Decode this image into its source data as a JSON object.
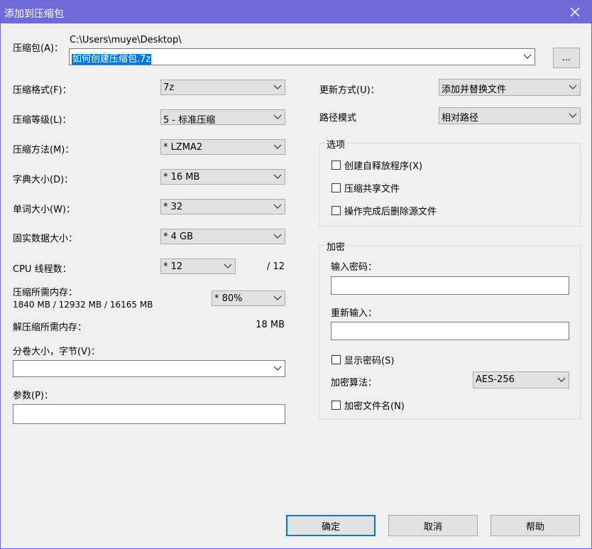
{
  "window": {
    "title": "添加到压缩包",
    "close_glyph": "✕"
  },
  "archive": {
    "label": "压缩包(A)：",
    "path": "C:\\Users\\muye\\Desktop\\",
    "name": "如何创建压缩包.7z",
    "browse": "..."
  },
  "left": {
    "format": {
      "label": "压缩格式(F)：",
      "value": "7z"
    },
    "level": {
      "label": "压缩等级(L)：",
      "value": "5 - 标准压缩"
    },
    "method": {
      "label": "压缩方法(M)：",
      "value": "* LZMA2"
    },
    "dict": {
      "label": "字典大小(D)：",
      "value": "* 16 MB"
    },
    "word": {
      "label": "单词大小(W)：",
      "value": "* 32"
    },
    "solid": {
      "label": "固实数据大小：",
      "value": "* 4 GB"
    },
    "threads": {
      "label": "CPU 线程数：",
      "value": "* 12",
      "max": "/ 12"
    },
    "mem": {
      "label": "压缩所需内存：",
      "detail": "1840 MB / 12932 MB / 16165 MB",
      "value": "* 80%"
    },
    "decomp": {
      "label": "解压缩所需内存：",
      "value": "18 MB"
    },
    "volume": {
      "label": "分卷大小，字节(V)：",
      "value": ""
    },
    "params": {
      "label": "参数(P)：",
      "value": ""
    }
  },
  "right": {
    "update": {
      "label": "更新方式(U)：",
      "value": "添加并替换文件"
    },
    "pathmode": {
      "label": "路径模式",
      "value": "相对路径"
    },
    "options": {
      "legend": "选项",
      "sfx": "创建自释放程序(X)",
      "shared": "压缩共享文件",
      "delete": "操作完成后删除源文件"
    },
    "encryption": {
      "legend": "加密",
      "pwd_label": "输入密码：",
      "pwd_value": "",
      "repwd_label": "重新输入：",
      "repwd_value": "",
      "show": "显示密码(S)",
      "method_label": "加密算法：",
      "method_value": "AES-256",
      "names": "加密文件名(N)"
    }
  },
  "buttons": {
    "ok": "确定",
    "cancel": "取消",
    "help": "帮助"
  }
}
